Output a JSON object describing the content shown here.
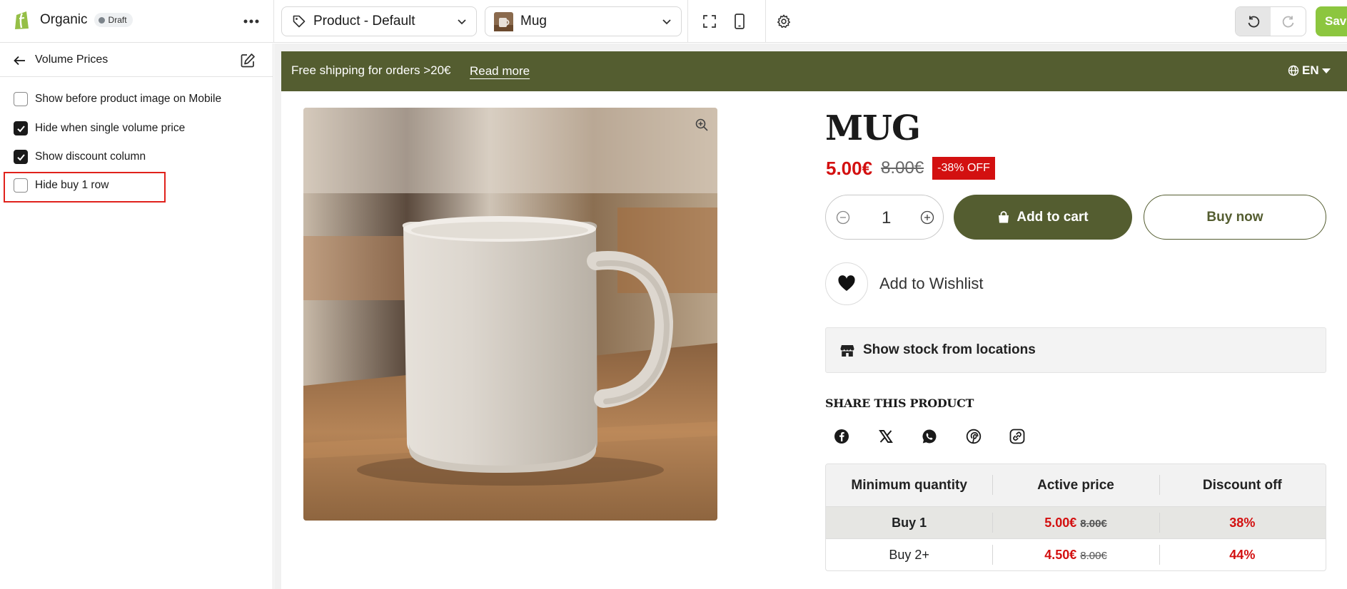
{
  "topbar": {
    "app_name": "Organic",
    "status_badge": "Draft",
    "template_select": "Product - Default",
    "product_select": "Mug",
    "save_label": "Save"
  },
  "sidebar": {
    "title": "Volume Prices",
    "options": [
      {
        "label": "Show before product image on Mobile",
        "checked": false
      },
      {
        "label": "Hide when single volume price",
        "checked": true
      },
      {
        "label": "Show discount column",
        "checked": true
      },
      {
        "label": "Hide buy 1 row",
        "checked": false
      }
    ]
  },
  "announcement": {
    "message": "Free shipping for orders >20€",
    "link": "Read more",
    "language": "EN"
  },
  "product": {
    "title": "MUG",
    "price": "5.00€",
    "compare_price": "8.00€",
    "discount_badge": "-38% OFF",
    "quantity": "1",
    "add_to_cart": "Add to cart",
    "buy_now": "Buy now",
    "wishlist": "Add to Wishlist",
    "stock_label": "Show stock from locations",
    "share_title": "SHARE THIS PRODUCT",
    "share_icons": [
      "facebook-icon",
      "x-icon",
      "whatsapp-icon",
      "pinterest-icon",
      "copy-link-icon"
    ]
  },
  "volume_prices": {
    "headers": [
      "Minimum quantity",
      "Active price",
      "Discount off"
    ],
    "rows": [
      {
        "label": "Buy 1",
        "price": "5.00€",
        "was": "8.00€",
        "discount": "38%"
      },
      {
        "label": "Buy 2+",
        "price": "4.50€",
        "was": "8.00€",
        "discount": "44%"
      }
    ]
  },
  "colors": {
    "brand_olive": "#545d30",
    "sale_red": "#d31010",
    "save_green": "#8cc63f",
    "highlight": "#e0211b"
  }
}
